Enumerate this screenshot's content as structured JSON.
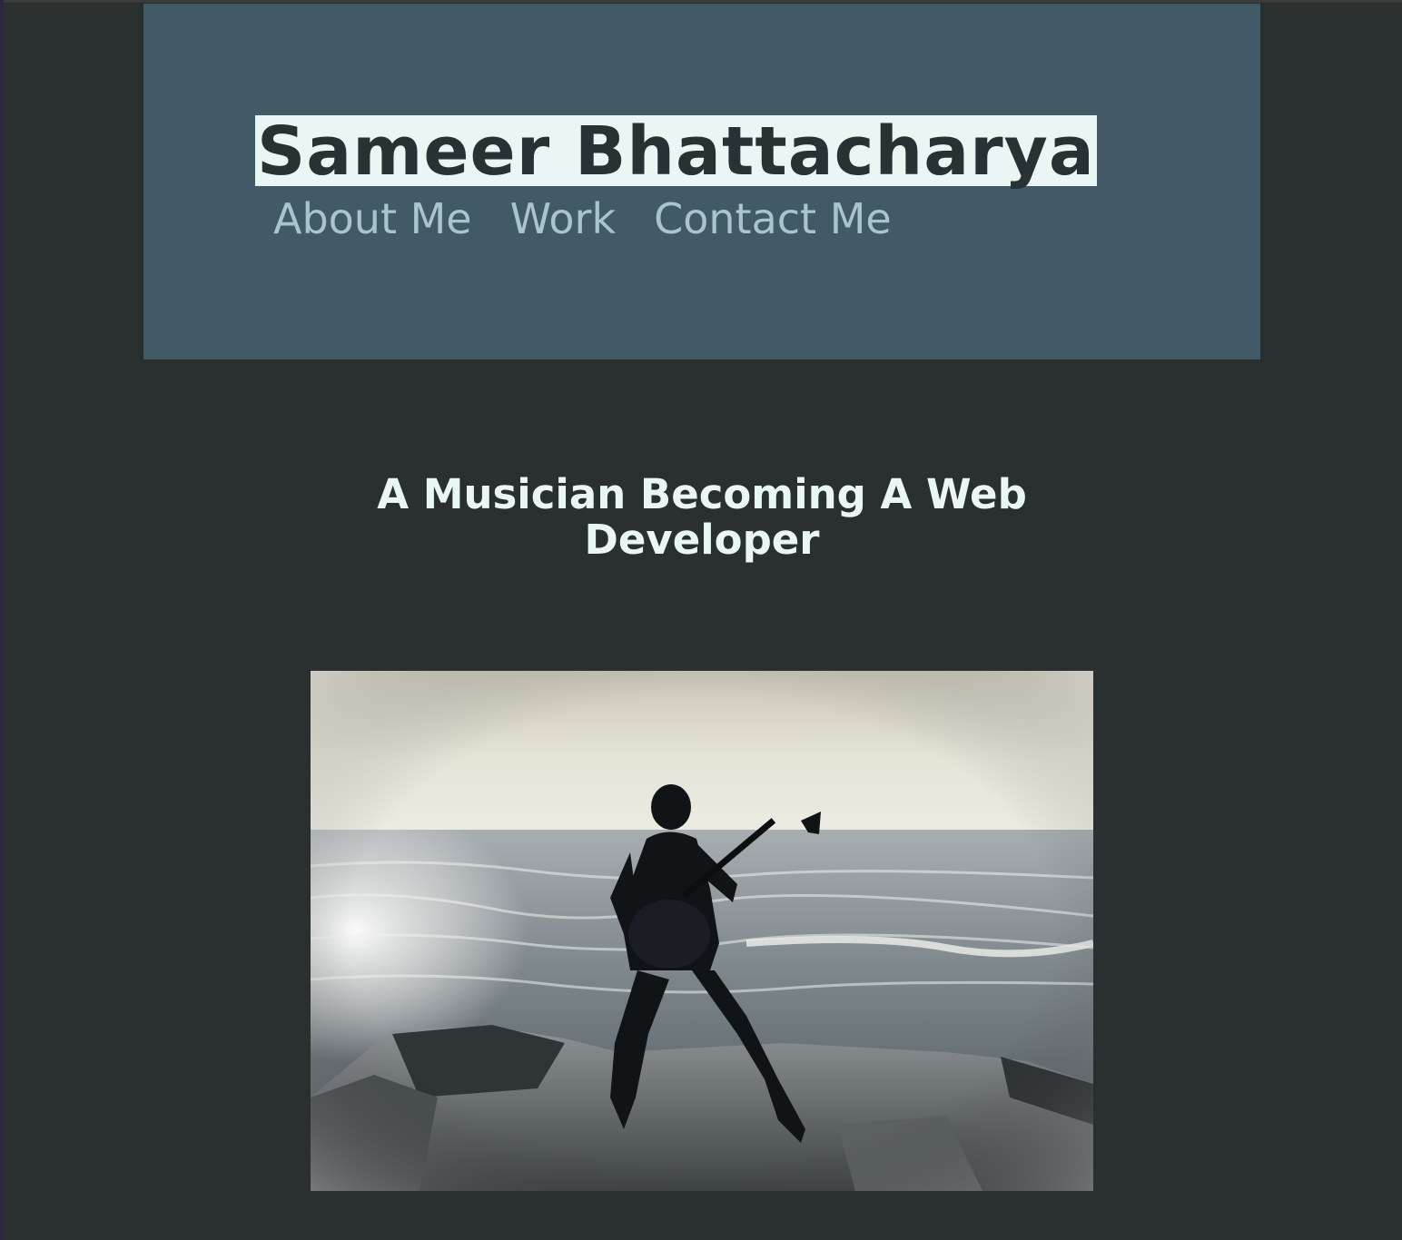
{
  "header": {
    "title": "Sameer Bhattacharya",
    "nav": [
      {
        "label": "About Me"
      },
      {
        "label": "Work"
      },
      {
        "label": "Contact Me"
      }
    ]
  },
  "main": {
    "tagline": "A Musician Becoming A Web Developer",
    "hero_image": {
      "subject": "guitarist-on-beach-rocks"
    }
  },
  "colors": {
    "page_background": "#2a2f30",
    "header_background": "#415a66",
    "title_highlight": "#e9f6f3",
    "title_text": "#283133",
    "nav_text": "#a9c5cb",
    "tagline_text": "#e9f6f3"
  }
}
